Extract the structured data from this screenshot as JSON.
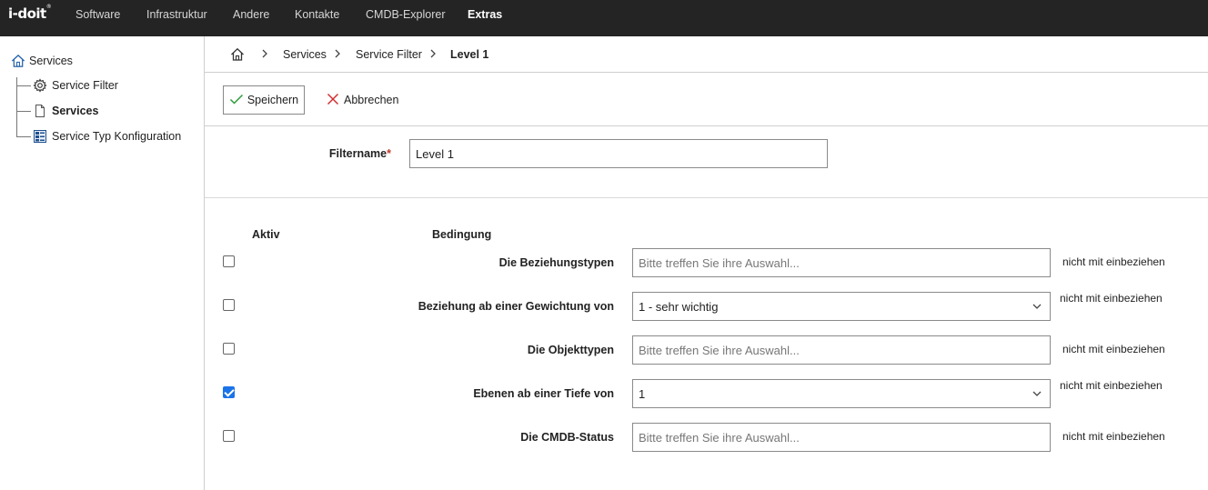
{
  "app": {
    "logo": "i-doit",
    "logo_sup": "®"
  },
  "nav": [
    {
      "label": "Software"
    },
    {
      "label": "Infrastruktur"
    },
    {
      "label": "Andere"
    },
    {
      "label": "Kontakte"
    },
    {
      "label": "CMDB-Explorer"
    },
    {
      "label": "Extras"
    }
  ],
  "sidebar": {
    "root": "Services",
    "items": [
      {
        "label": "Service Filter",
        "icon": "gear-icon"
      },
      {
        "label": "Services",
        "icon": "document-icon"
      },
      {
        "label": "Service Typ Konfiguration",
        "icon": "config-icon"
      }
    ]
  },
  "breadcrumb": [
    "Services",
    "Service Filter",
    "Level 1"
  ],
  "toolbar": {
    "save_label": "Speichern",
    "cancel_label": "Abbrechen"
  },
  "filter": {
    "name_label": "Filtername",
    "required_mark": "*",
    "name_value": "Level 1"
  },
  "conditions": {
    "col_active": "Aktiv",
    "col_condition": "Bedingung",
    "rows": [
      {
        "label": "Die Beziehungstypen",
        "type": "input",
        "placeholder": "Bitte treffen Sie ihre Auswahl...",
        "checked": false,
        "note": "nicht mit einbeziehen"
      },
      {
        "label": "Beziehung ab einer Gewichtung von",
        "type": "select",
        "value": "1 - sehr wichtig",
        "checked": false,
        "note": "nicht mit einbeziehen"
      },
      {
        "label": "Die Objekttypen",
        "type": "input",
        "placeholder": "Bitte treffen Sie ihre Auswahl...",
        "checked": false,
        "note": "nicht mit einbeziehen"
      },
      {
        "label": "Ebenen ab einer Tiefe von",
        "type": "select",
        "value": "1",
        "checked": true,
        "note": "nicht mit einbeziehen"
      },
      {
        "label": "Die CMDB-Status",
        "type": "input",
        "placeholder": "Bitte treffen Sie ihre Auswahl...",
        "checked": false,
        "note": "nicht mit einbeziehen"
      }
    ]
  },
  "colors": {
    "topbar": "#242424",
    "check_accent": "#1a73e8",
    "save_check": "#2e9b3a",
    "cancel_x": "#d32f2f",
    "required": "#c0392b"
  }
}
